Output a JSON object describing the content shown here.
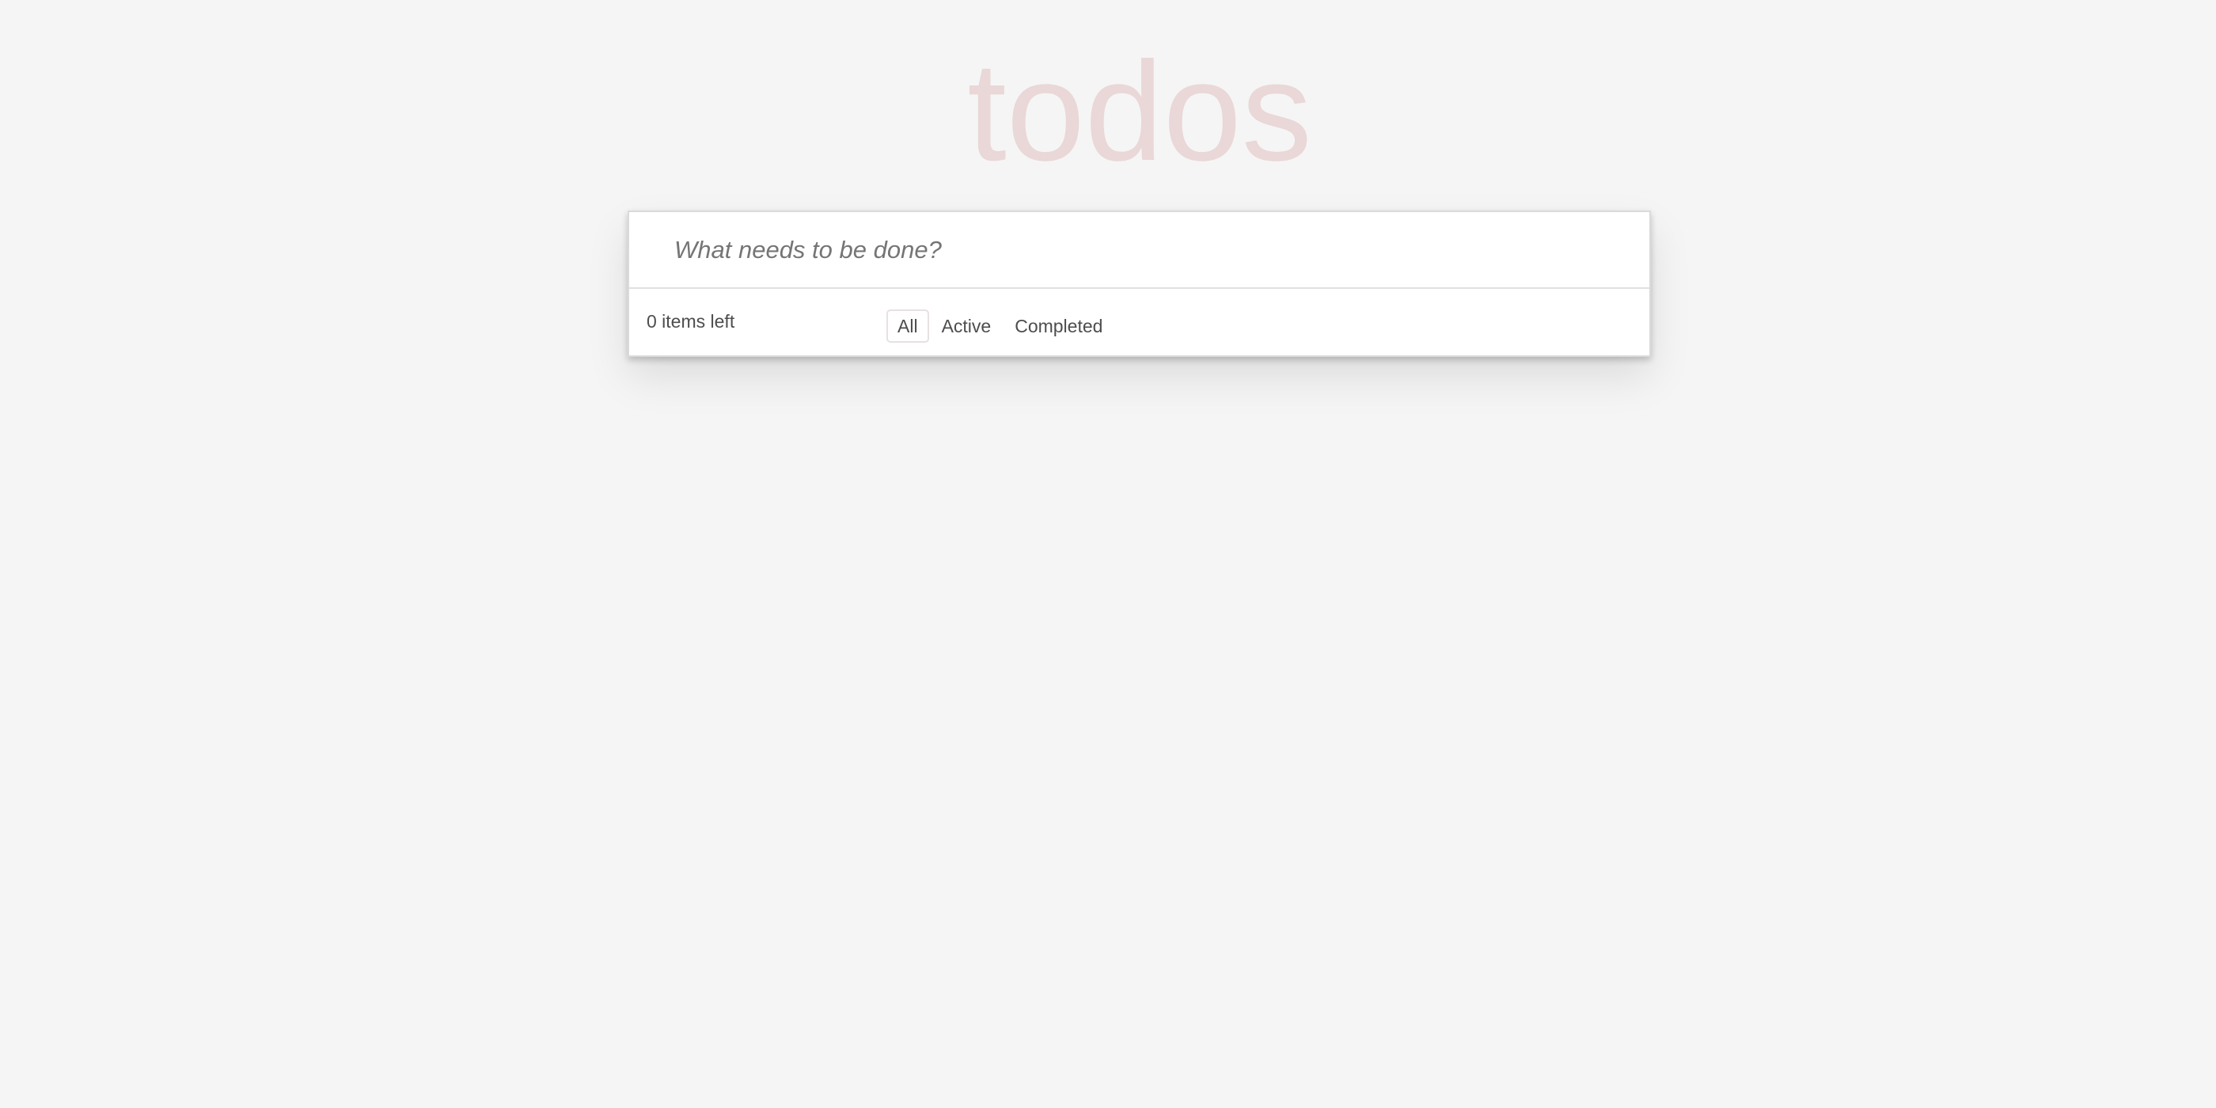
{
  "header": {
    "title": "todos"
  },
  "new_todo": {
    "placeholder": "What needs to be done?",
    "value": ""
  },
  "footer": {
    "count_text": "0 items left",
    "filters": [
      {
        "label": "All",
        "selected": true
      },
      {
        "label": "Active",
        "selected": false
      },
      {
        "label": "Completed",
        "selected": false
      }
    ]
  },
  "colors": {
    "background": "#f5f5f5",
    "title": "#ead7d7",
    "text": "#4d4d4d",
    "placeholder": "#757575",
    "panel": "#ffffff"
  }
}
